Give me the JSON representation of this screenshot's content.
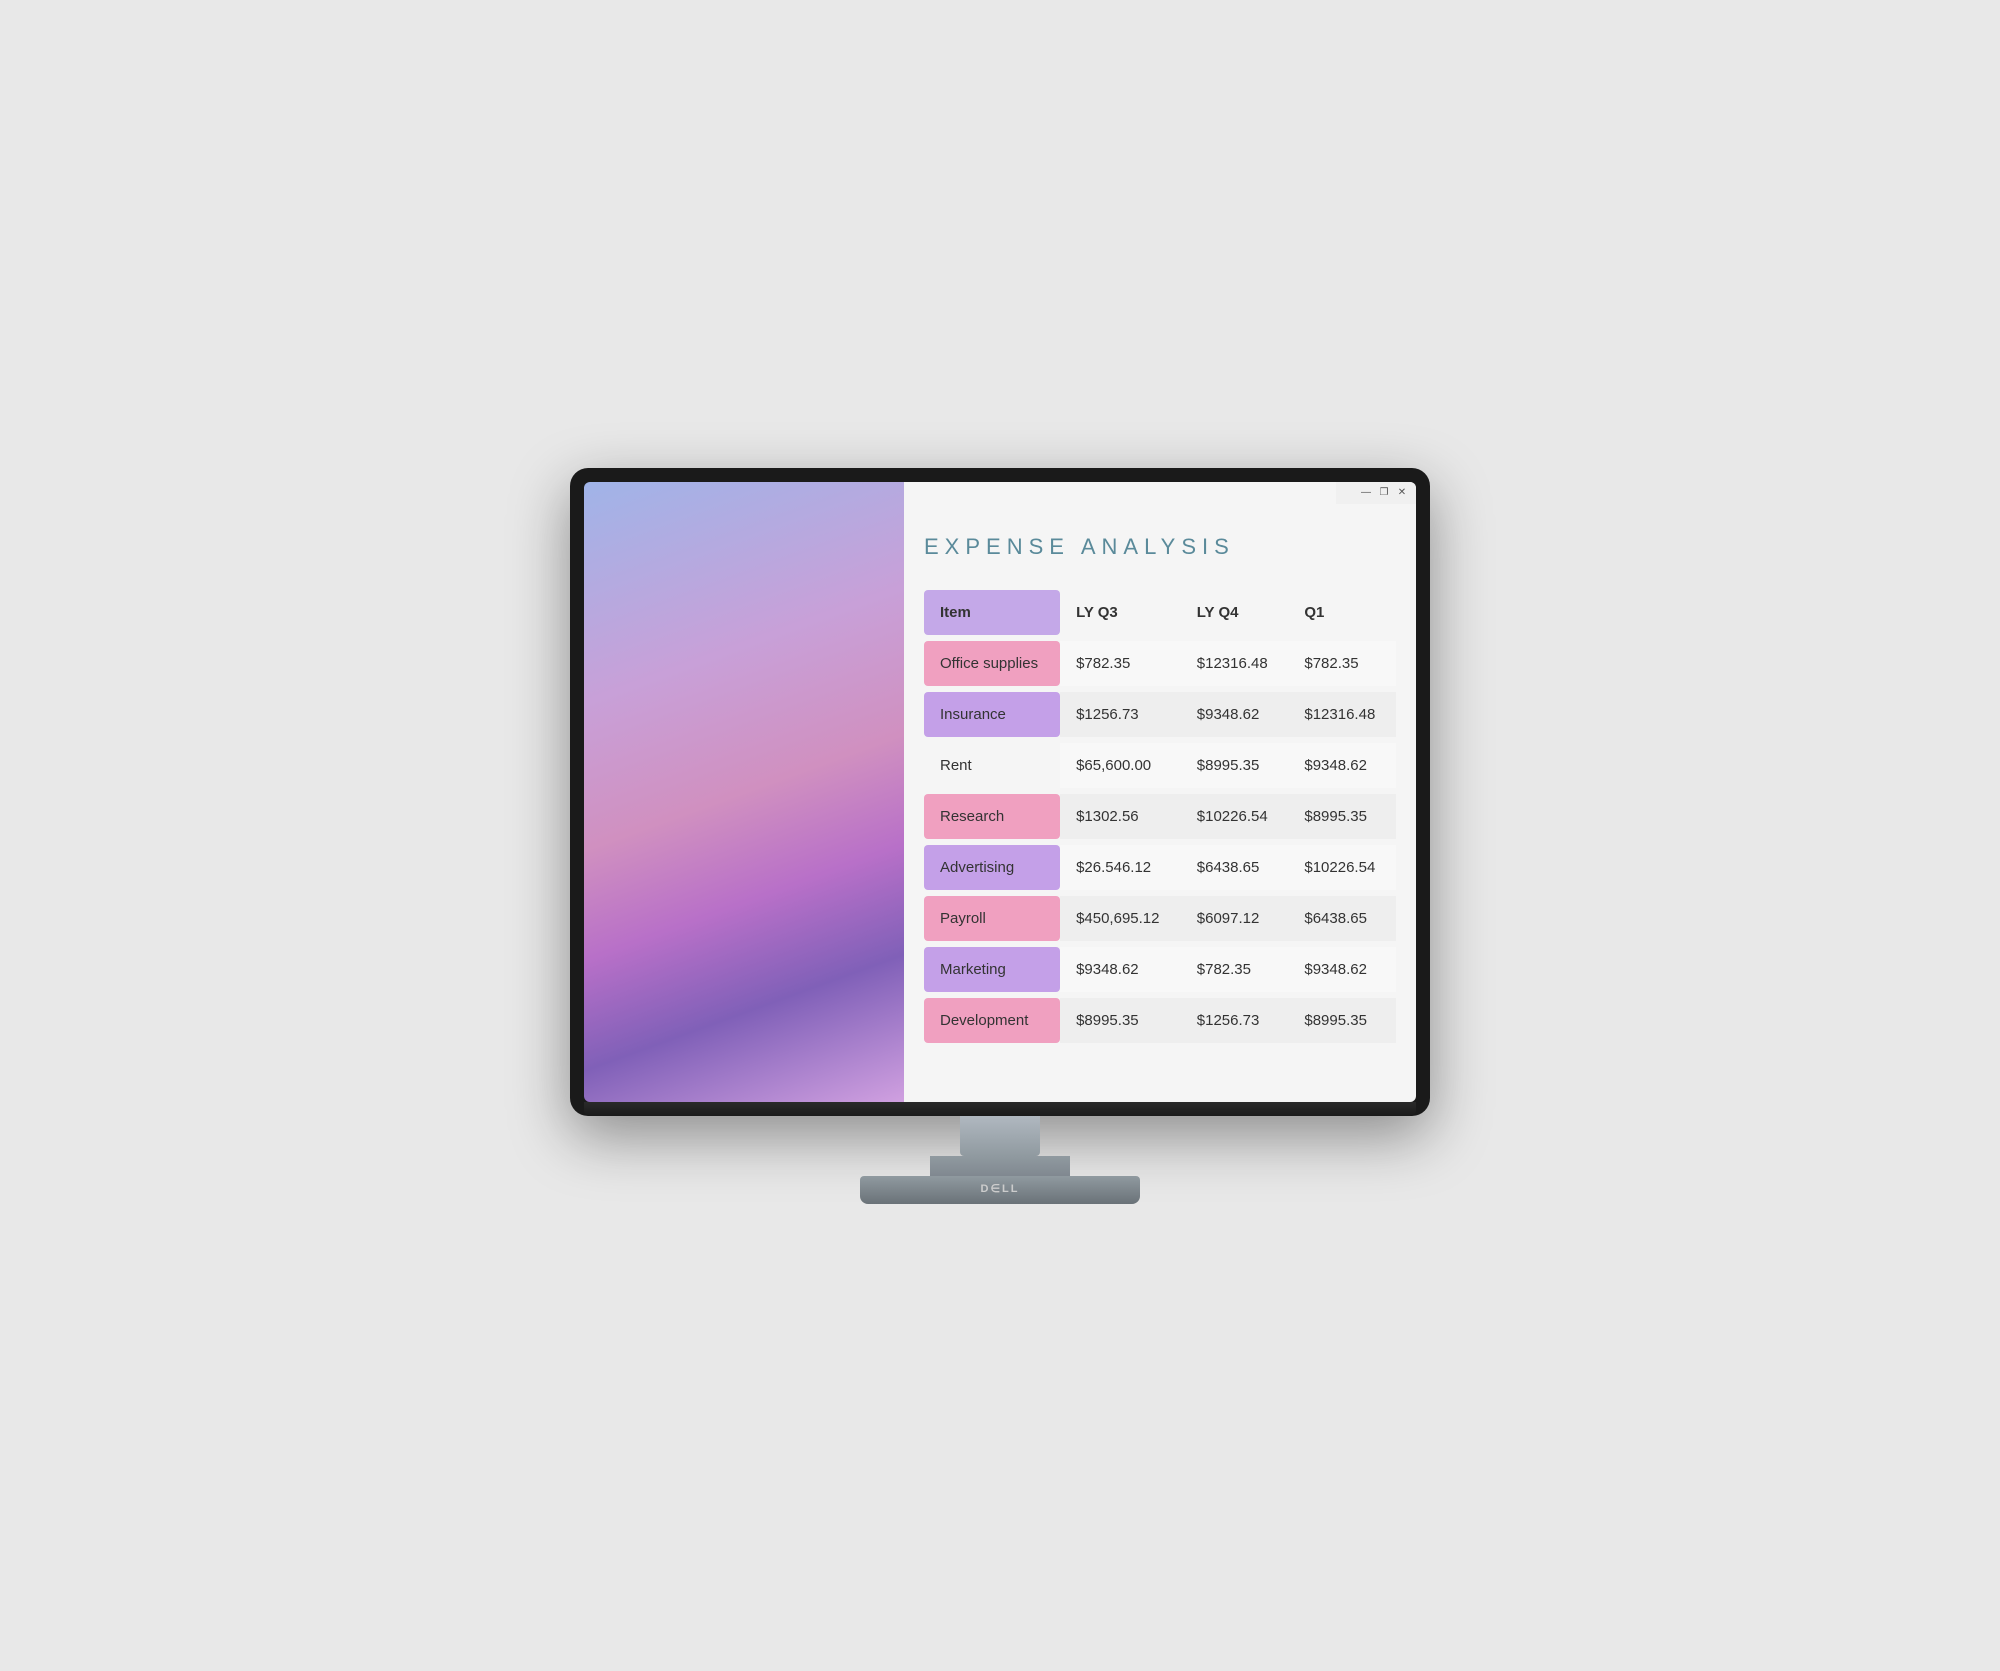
{
  "window": {
    "title": "Expense Analysis",
    "controls": {
      "minimize": "—",
      "restore": "❐",
      "close": "✕"
    }
  },
  "spreadsheet": {
    "title": "EXPENSE ANALYSIS",
    "columns": [
      {
        "id": "item",
        "label": "Item"
      },
      {
        "id": "lyq3",
        "label": "LY Q3"
      },
      {
        "id": "lyq4",
        "label": "LY Q4"
      },
      {
        "id": "q1",
        "label": "Q1"
      }
    ],
    "rows": [
      {
        "item": "Office supplies",
        "lyq3": "$782.35",
        "lyq4": "$12316.48",
        "q1": "$782.35",
        "color": "pink"
      },
      {
        "item": "Insurance",
        "lyq3": "$1256.73",
        "lyq4": "$9348.62",
        "q1": "$12316.48",
        "color": "purple"
      },
      {
        "item": "Rent",
        "lyq3": "$65,600.00",
        "lyq4": "$8995.35",
        "q1": "$9348.62",
        "color": "none"
      },
      {
        "item": "Research",
        "lyq3": "$1302.56",
        "lyq4": "$10226.54",
        "q1": "$8995.35",
        "color": "pink"
      },
      {
        "item": "Advertising",
        "lyq3": "$26.546.12",
        "lyq4": "$6438.65",
        "q1": "$10226.54",
        "color": "purple"
      },
      {
        "item": "Payroll",
        "lyq3": "$450,695.12",
        "lyq4": "$6097.12",
        "q1": "$6438.65",
        "color": "pink"
      },
      {
        "item": "Marketing",
        "lyq3": "$9348.62",
        "lyq4": "$782.35",
        "q1": "$9348.62",
        "color": "purple"
      },
      {
        "item": "Development",
        "lyq3": "$8995.35",
        "lyq4": "$1256.73",
        "q1": "$8995.35",
        "color": "pink"
      }
    ]
  },
  "monitor": {
    "brand": "D∈LL"
  }
}
